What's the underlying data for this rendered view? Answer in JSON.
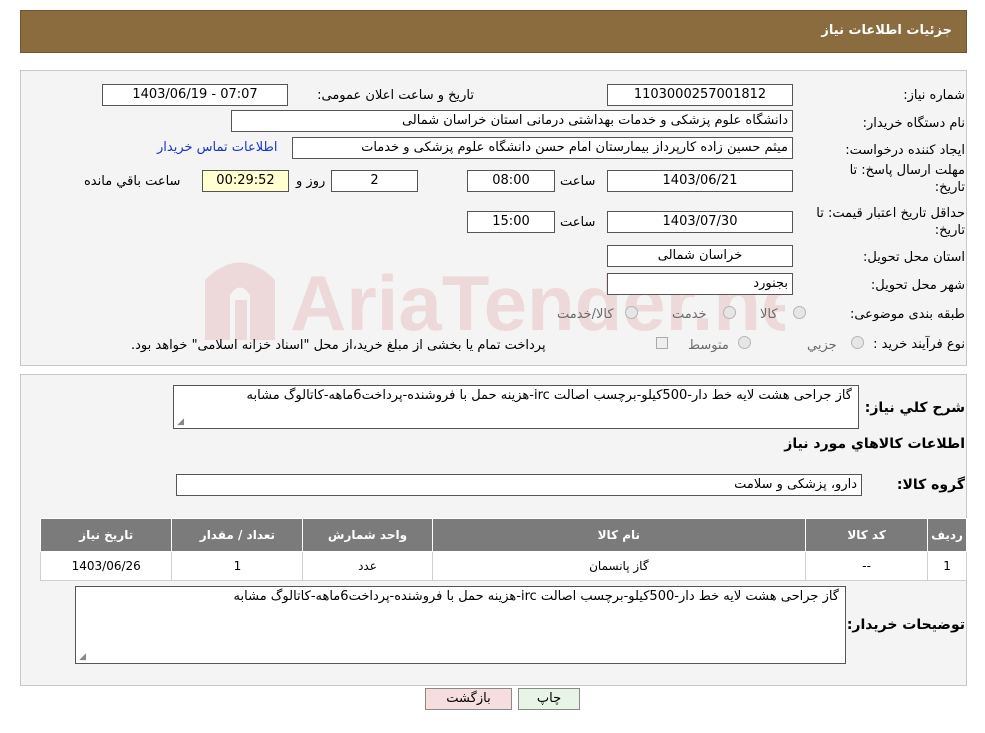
{
  "header": {
    "title": "جزئیات اطلاعات نیاز"
  },
  "form": {
    "need_number": {
      "label": "شماره نیاز:",
      "value": "1103000257001812"
    },
    "announce_datetime": {
      "label": "تاریخ و ساعت اعلان عمومی:",
      "value": "1403/06/19 - 07:07"
    },
    "buyer_org": {
      "label": "نام دستگاه خریدار:",
      "value": "دانشگاه علوم پزشکی و خدمات بهداشتی درمانی استان خراسان شمالی"
    },
    "requester": {
      "label": "ایجاد کننده درخواست:",
      "value": "میثم  حسین زاده  کارپرداز بیمارستان امام حسن دانشگاه علوم پزشکی و خدمات",
      "contact_link": "اطلاعات تماس خریدار"
    },
    "reply_deadline": {
      "label_line1": "مهلت ارسال پاسخ: تا",
      "label_line2": "تاریخ:",
      "date": "1403/06/21",
      "time_label": "ساعت",
      "time": "08:00",
      "days": "2",
      "days_label": "روز و",
      "remaining": "00:29:52",
      "remaining_label": "ساعت باقي مانده"
    },
    "price_validity": {
      "label_line1": "حداقل تاریخ اعتبار قیمت: تا",
      "label_line2": "تاریخ:",
      "date": "1403/07/30",
      "time_label": "ساعت",
      "time": "15:00"
    },
    "delivery_province": {
      "label": "استان محل تحویل:",
      "value": "خراسان شمالی"
    },
    "delivery_city": {
      "label": "شهر محل تحویل:",
      "value": "بجنورد"
    },
    "category": {
      "label": "طبقه بندی موضوعی:",
      "options": [
        "کالا",
        "خدمت",
        "کالا/خدمت"
      ]
    },
    "purchase_type": {
      "label": "نوع فرآیند خرید :",
      "options": [
        "جزیي",
        "متوسط"
      ],
      "note": "پرداخت تمام یا بخشی از مبلغ خرید،از محل \"اسناد خزانه اسلامی\" خواهد بود."
    }
  },
  "summary": {
    "label": "شرح کلي نياز:",
    "text": "گاز جراحی هشت لایه خط دار-500کیلو-برچسب اصالت irc-هزینه حمل با فروشنده-پرداخت6ماهه-کاتالوگ مشابه"
  },
  "goods_section_title": "اطلاعات کالاهاي مورد نياز",
  "goods_group": {
    "label": "گروه کالا:",
    "value": "دارو، پزشکی و سلامت"
  },
  "table": {
    "headers": [
      "ردیف",
      "کد کالا",
      "نام کالا",
      "واحد شمارش",
      "تعداد / مقدار",
      "تاریخ نیاز"
    ],
    "rows": [
      [
        "1",
        "--",
        "گاز پانسمان",
        "عدد",
        "1",
        "1403/06/26"
      ]
    ]
  },
  "buyer_notes": {
    "label": "توضیحات خریدار:",
    "text": "گاز جراحی هشت لایه خط دار-500کیلو-برچسب اصالت irc-هزینه حمل با فروشنده-پرداخت6ماهه-کاتالوگ مشابه"
  },
  "buttons": {
    "print": "چاپ",
    "back": "بازگشت"
  },
  "watermark": {
    "text": "AriaTender.neT"
  },
  "colors": {
    "header_bg": "#8b6c3e",
    "back_button": "#f7dede",
    "print_button": "#e6f5e6",
    "link": "#1a35c8"
  }
}
